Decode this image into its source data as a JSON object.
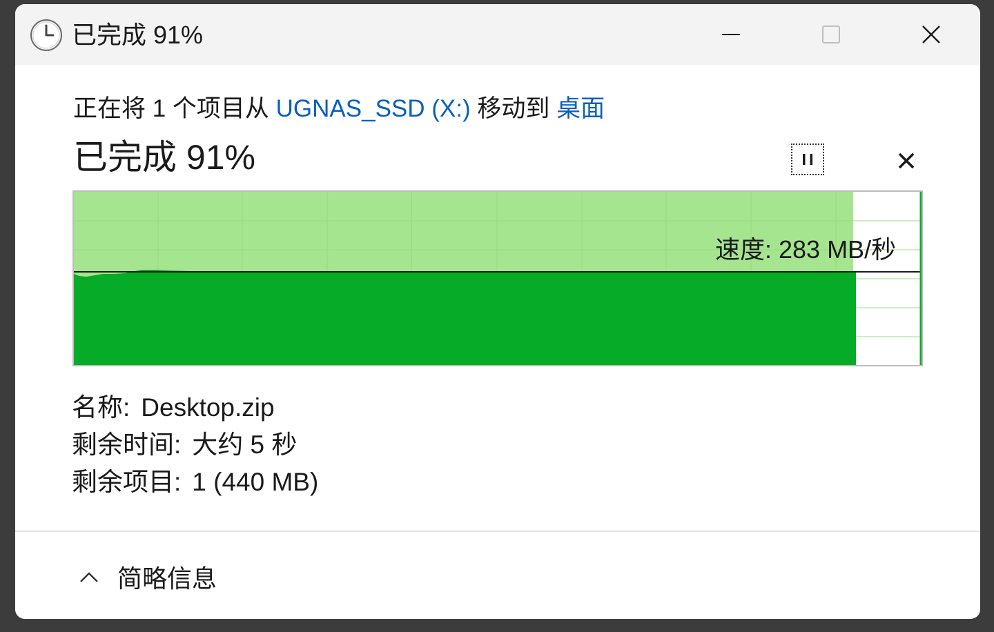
{
  "window": {
    "title": "已完成 91%",
    "controls": {
      "minimize": "minimize",
      "maximize": "maximize",
      "close": "close"
    }
  },
  "operation": {
    "prefix": "正在将 1 个项目从 ",
    "source": "UGNAS_SSD (X:)",
    "middle": " 移动到 ",
    "destination": "桌面"
  },
  "progress": {
    "heading": "已完成 91%",
    "percent": 91
  },
  "speed": {
    "label": "速度: 283 MB/秒"
  },
  "details": {
    "name_label": "名称:",
    "name_value": "Desktop.zip",
    "time_label": "剩余时间:",
    "time_value": "大约 5 秒",
    "items_label": "剩余项目:",
    "items_value": "1 (440 MB)"
  },
  "footer": {
    "toggle_label": "简略信息"
  },
  "colors": {
    "progress_light": "#a6e58f",
    "throughput_fill": "#06ab27",
    "grid_line": "#8fdb77",
    "link": "#0a5fbd"
  },
  "icons": {
    "title": "clock-icon",
    "pause": "pause-icon",
    "cancel": "close-icon",
    "toggle": "chevron-up-icon"
  }
}
